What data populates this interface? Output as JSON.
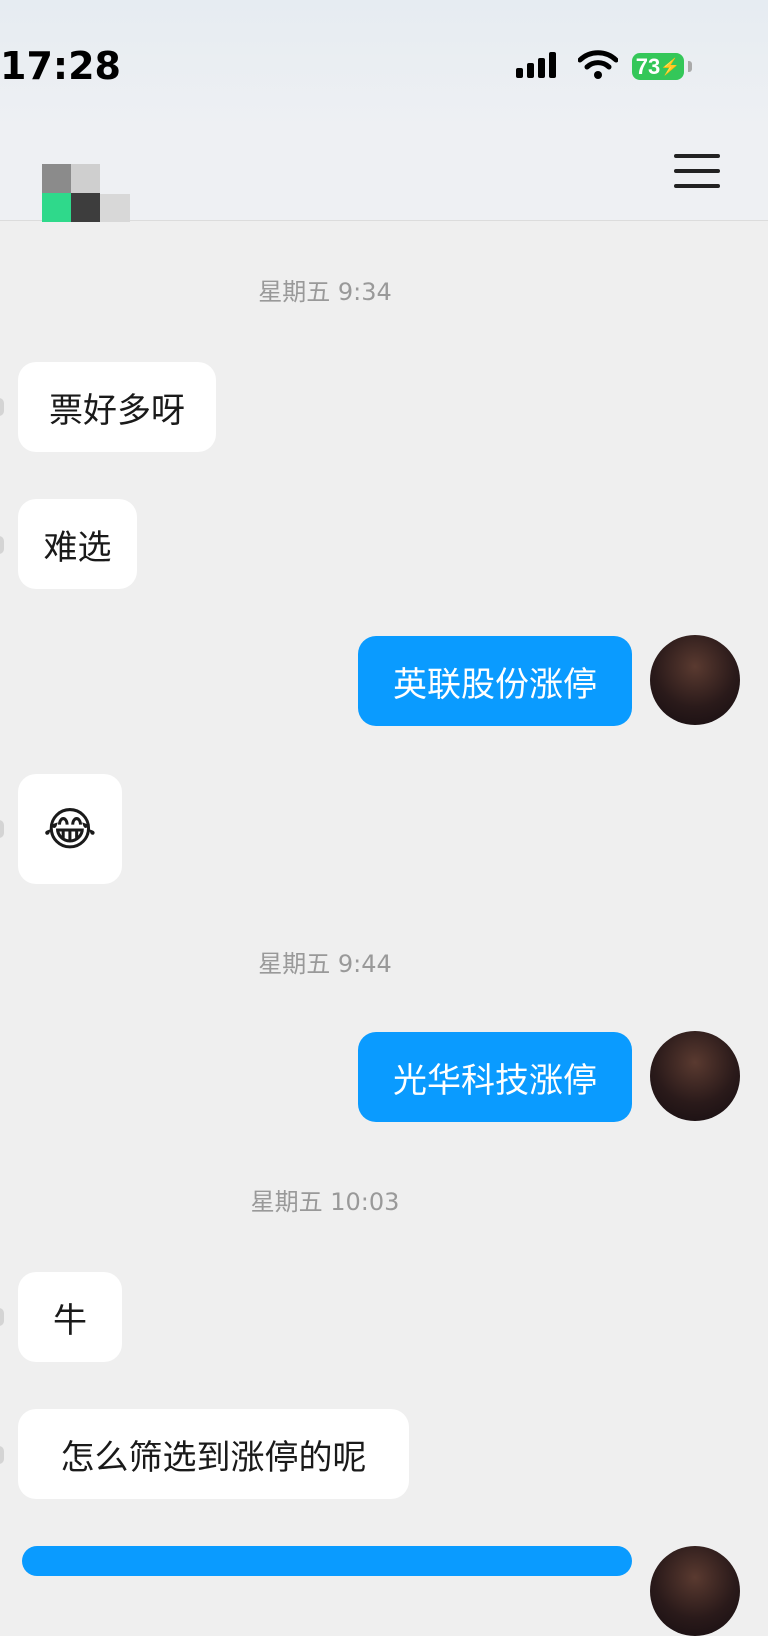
{
  "status_bar": {
    "time": "17:28",
    "battery": "73"
  },
  "header": {
    "menu_icon": "hamburger-menu-icon"
  },
  "messages": [
    {
      "type": "timestamp",
      "text": "星期五 9:34"
    },
    {
      "type": "incoming",
      "text": "票好多呀"
    },
    {
      "type": "incoming",
      "text": "难选"
    },
    {
      "type": "outgoing",
      "text": "英联股份涨停"
    },
    {
      "type": "incoming",
      "text": "😂"
    },
    {
      "type": "timestamp",
      "text": "星期五 9:44"
    },
    {
      "type": "outgoing",
      "text": "光华科技涨停"
    },
    {
      "type": "timestamp",
      "text": "星期五 10:03"
    },
    {
      "type": "incoming",
      "text": "牛"
    },
    {
      "type": "incoming",
      "text": "怎么筛选到涨停的呢"
    }
  ],
  "colors": {
    "outgoing_bubble": "#0a9bff",
    "incoming_bubble": "#ffffff",
    "background": "#efefef"
  }
}
